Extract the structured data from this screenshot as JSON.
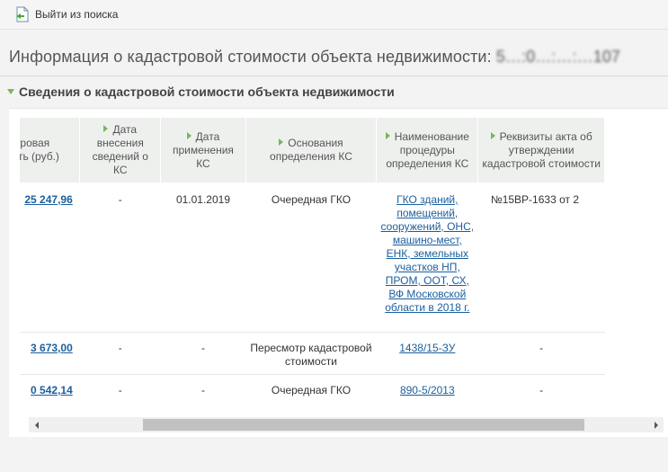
{
  "toolbar": {
    "back_label": "Выйти из поиска"
  },
  "page": {
    "title_prefix": "Информация о кадастровой стоимости объекта недвижимости:",
    "title_number": "5…:0…:…:…107"
  },
  "section": {
    "title": "Сведения о кадастровой стоимости объекта недвижимости"
  },
  "table": {
    "headers": [
      "кадастровая стоимость (руб.)",
      "Дата внесения сведений о КС",
      "Дата применения КС",
      "Основания определения КС",
      "Наименование процедуры определения КС",
      "Реквизиты акта об утверждении кадастровой стоимости"
    ],
    "rows": [
      {
        "value": "25 247,96",
        "date_entered": "-",
        "date_applied": "01.01.2019",
        "basis": "Очередная ГКО",
        "procedure": "ГКО зданий, помещений, сооружений, ОНС, машино-мест, ЕНК, земельных участков НП, ПРОМ, ООТ, СХ, ВФ Московской области в 2018 г.",
        "act": "№15ВР-1633 от 2"
      },
      {
        "value": "3 673,00",
        "date_entered": "-",
        "date_applied": "-",
        "basis": "Пересмотр кадастровой стоимости",
        "procedure": "1438/15-ЗУ",
        "act": "-"
      },
      {
        "value": "0 542,14",
        "date_entered": "-",
        "date_applied": "-",
        "basis": "Очередная ГКО",
        "procedure": "890-5/2013",
        "act": "-"
      }
    ]
  },
  "colors": {
    "accent": "#7ab55c",
    "link": "#1a5f9e",
    "header_bg": "#eef0ee"
  }
}
